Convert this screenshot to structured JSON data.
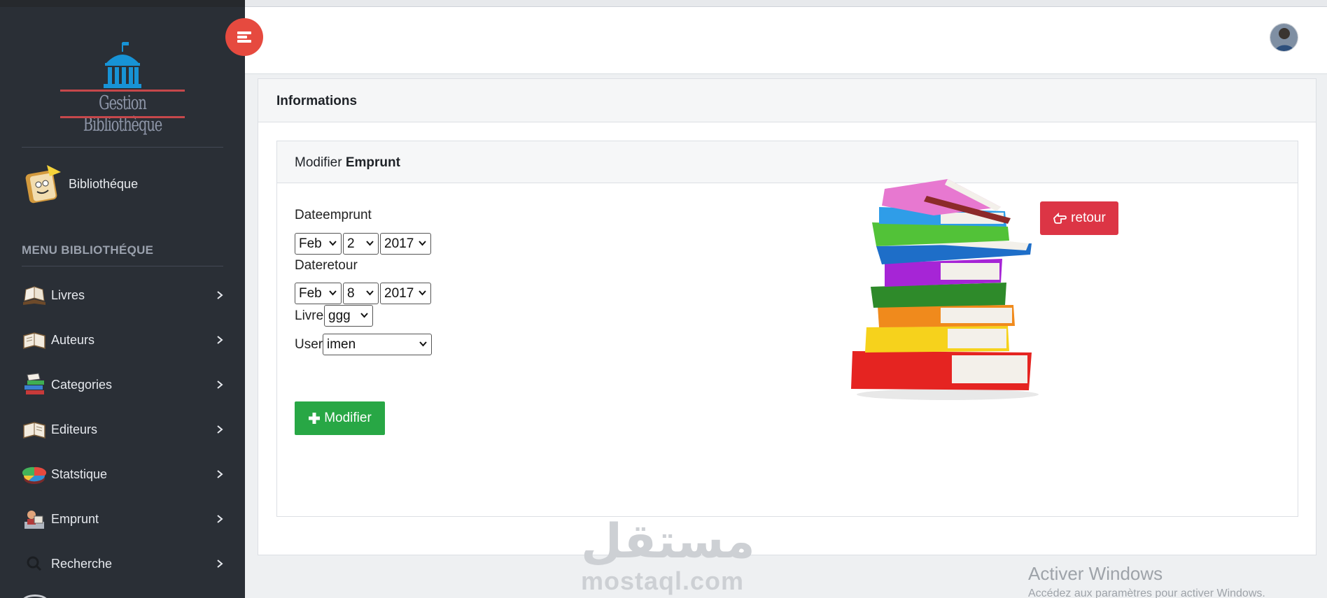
{
  "sidebar": {
    "logo_text": "Gestion Bibliothèque",
    "profile_label": "Bibliothéque",
    "menu_title": "MENU BIBLIOTHÉQUE",
    "items": [
      {
        "label": "Livres",
        "icon": "open-book-icon"
      },
      {
        "label": "Auteurs",
        "icon": "book-icon"
      },
      {
        "label": "Categories",
        "icon": "books-stack-icon"
      },
      {
        "label": "Editeurs",
        "icon": "book-icon"
      },
      {
        "label": "Statstique",
        "icon": "pie-chart-icon"
      },
      {
        "label": "Emprunt",
        "icon": "reader-icon"
      },
      {
        "label": "Recherche",
        "icon": "search-icon"
      }
    ]
  },
  "header": {
    "toggle_icon": "menu-toggle-icon",
    "avatar_icon": "user-avatar"
  },
  "main": {
    "card_title": "Informations",
    "form_title_prefix": "Modifier",
    "form_title_bold": "Emprunt",
    "retour_label": "retour",
    "fields": {
      "dateemprunt_label": "Dateemprunt",
      "dateemprunt_month": "Feb",
      "dateemprunt_day": "2",
      "dateemprunt_year": "2017",
      "dateretour_label": "Dateretour",
      "dateretour_month": "Feb",
      "dateretour_day": "8",
      "dateretour_year": "2017",
      "livre_label": "Livre",
      "livre_value": "ggg",
      "user_label": "User",
      "user_value": "imen"
    },
    "submit_label": "Modifier"
  },
  "overlay": {
    "watermark_arabic": "مستقل",
    "watermark_latin": "mostaql.com",
    "activate_title": "Activer Windows",
    "activate_sub": "Accédez aux paramètres pour activer Windows."
  },
  "colors": {
    "sidebar_bg": "#2a2f36",
    "toggle": "#e64a3f",
    "retour": "#dc3545",
    "submit": "#28a745"
  }
}
